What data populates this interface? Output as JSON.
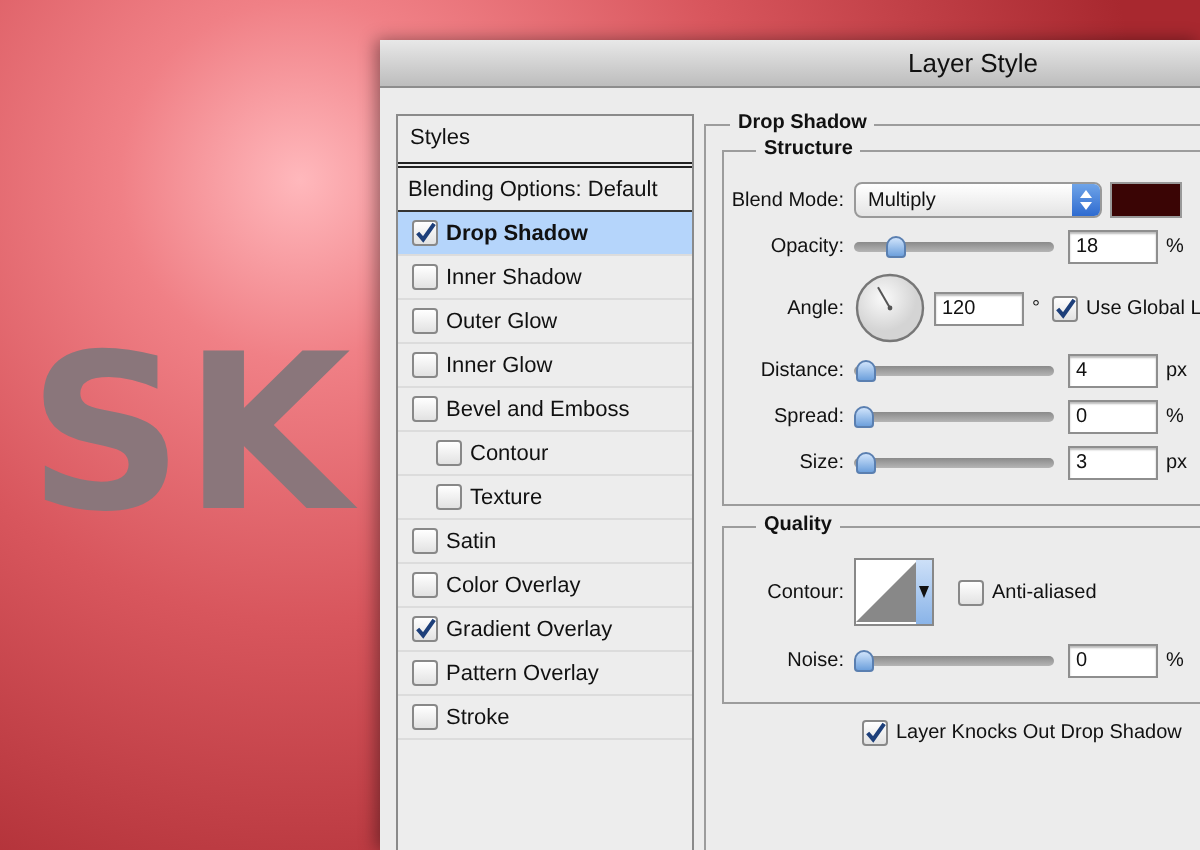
{
  "canvas": {
    "text": "SK"
  },
  "window": {
    "title": "Layer Style"
  },
  "styles_panel": {
    "header": "Styles",
    "items": [
      {
        "label": "Blending Options: Default",
        "kind": "heading",
        "selected": false
      },
      {
        "label": "Drop Shadow",
        "kind": "effect",
        "checked": true,
        "selected": true
      },
      {
        "label": "Inner Shadow",
        "kind": "effect",
        "checked": false,
        "selected": false
      },
      {
        "label": "Outer Glow",
        "kind": "effect",
        "checked": false,
        "selected": false
      },
      {
        "label": "Inner Glow",
        "kind": "effect",
        "checked": false,
        "selected": false
      },
      {
        "label": "Bevel and Emboss",
        "kind": "effect",
        "checked": false,
        "selected": false,
        "children": [
          {
            "label": "Contour",
            "kind": "effect",
            "checked": false,
            "selected": false
          },
          {
            "label": "Texture",
            "kind": "effect",
            "checked": false,
            "selected": false
          }
        ]
      },
      {
        "label": "Satin",
        "kind": "effect",
        "checked": false,
        "selected": false
      },
      {
        "label": "Color Overlay",
        "kind": "effect",
        "checked": false,
        "selected": false
      },
      {
        "label": "Gradient Overlay",
        "kind": "effect",
        "checked": true,
        "selected": false
      },
      {
        "label": "Pattern Overlay",
        "kind": "effect",
        "checked": false,
        "selected": false
      },
      {
        "label": "Stroke",
        "kind": "effect",
        "checked": false,
        "selected": false
      }
    ]
  },
  "drop_shadow": {
    "title": "Drop Shadow",
    "structure": {
      "title": "Structure",
      "rows": [
        {
          "kind": "dropdown",
          "label": "Blend Mode:",
          "value": "Multiply",
          "color": "#3a0505"
        },
        {
          "kind": "slider",
          "label": "Opacity:",
          "level": 0.18,
          "value": "18",
          "unit": "%"
        },
        {
          "kind": "angle",
          "label": "Angle:",
          "value": "120",
          "unit": "°",
          "option": {
            "label": "Use Global L",
            "checked": true
          }
        },
        {
          "kind": "slider",
          "label": "Distance:",
          "level": 0.01,
          "value": "4",
          "unit": "px"
        },
        {
          "kind": "slider",
          "label": "Spread:",
          "level": 0,
          "value": "0",
          "unit": "%"
        },
        {
          "kind": "slider",
          "label": "Size:",
          "level": 0.01,
          "value": "3",
          "unit": "px"
        }
      ]
    },
    "quality": {
      "title": "Quality",
      "rows": [
        {
          "kind": "contour",
          "label": "Contour:",
          "option": {
            "label": "Anti-aliased",
            "checked": false
          }
        },
        {
          "kind": "slider",
          "label": "Noise:",
          "level": 0,
          "value": "0",
          "unit": "%"
        }
      ]
    },
    "knockout": {
      "label": "Layer Knocks Out Drop Shadow",
      "checked": true
    }
  }
}
